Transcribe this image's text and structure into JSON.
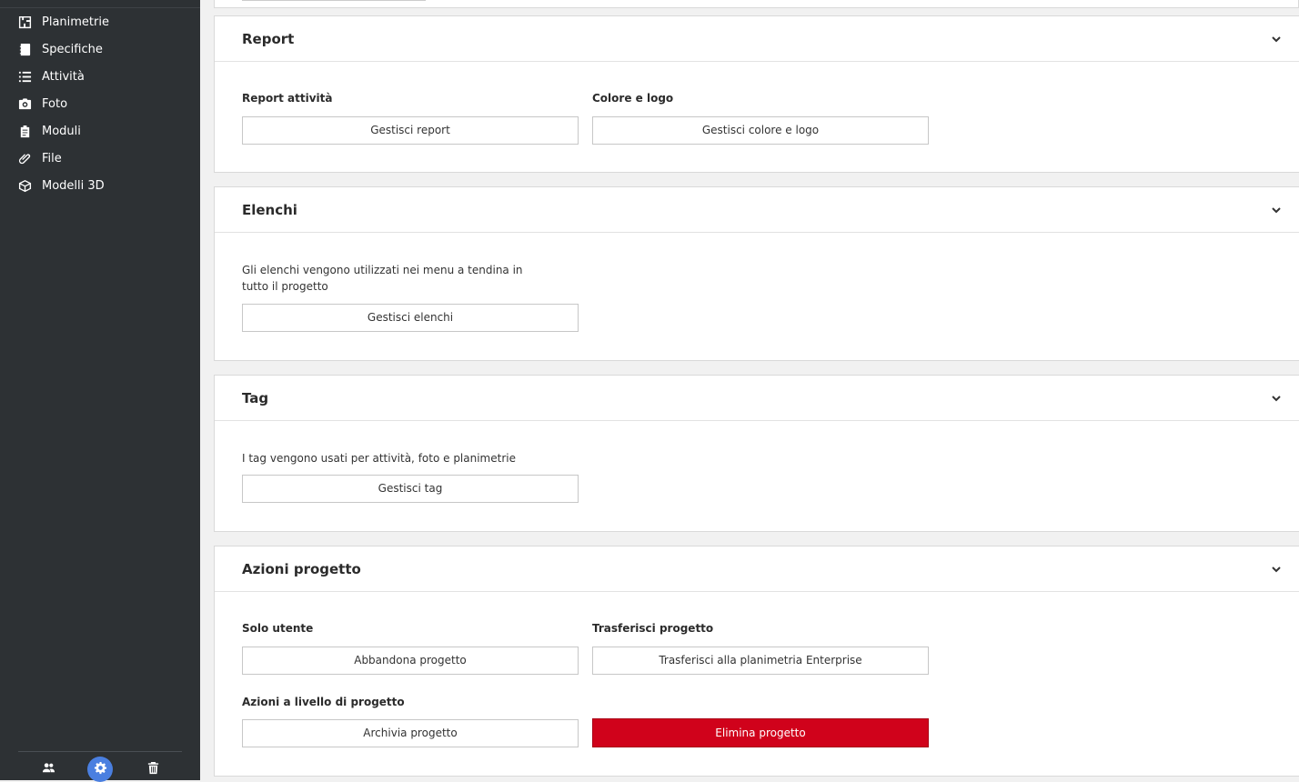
{
  "sidebar": {
    "items": [
      {
        "label": "Planimetrie",
        "icon": "floorplan-icon"
      },
      {
        "label": "Specifiche",
        "icon": "notebook-icon"
      },
      {
        "label": "Attività",
        "icon": "list-icon"
      },
      {
        "label": "Foto",
        "icon": "camera-icon"
      },
      {
        "label": "Moduli",
        "icon": "clipboard-icon"
      },
      {
        "label": "File",
        "icon": "paperclip-icon"
      },
      {
        "label": "Modelli 3D",
        "icon": "cube-icon"
      }
    ],
    "bottom": [
      "users-icon",
      "gear-icon",
      "trash-icon"
    ]
  },
  "sections": {
    "report": {
      "title": "Report",
      "activity_label": "Report attività",
      "activity_button": "Gestisci report",
      "color_label": "Colore e logo",
      "color_button": "Gestisci colore e logo"
    },
    "lists": {
      "title": "Elenchi",
      "description": "Gli elenchi vengono utilizzati nei menu a tendina in tutto il progetto",
      "button": "Gestisci elenchi"
    },
    "tags": {
      "title": "Tag",
      "description": "I tag vengono usati per attività, foto e planimetrie",
      "button": "Gestisci tag"
    },
    "actions": {
      "title": "Azioni progetto",
      "user_label": "Solo utente",
      "leave_button": "Abbandona progetto",
      "transfer_label": "Trasferisci progetto",
      "transfer_button": "Trasferisci alla planimetria Enterprise",
      "project_label": "Azioni a livello di progetto",
      "archive_button": "Archivia progetto",
      "delete_button": "Elimina progetto"
    }
  },
  "colors": {
    "sidebar_bg": "#2d3134",
    "accent": "#4a7fe0",
    "danger": "#d0021b"
  }
}
